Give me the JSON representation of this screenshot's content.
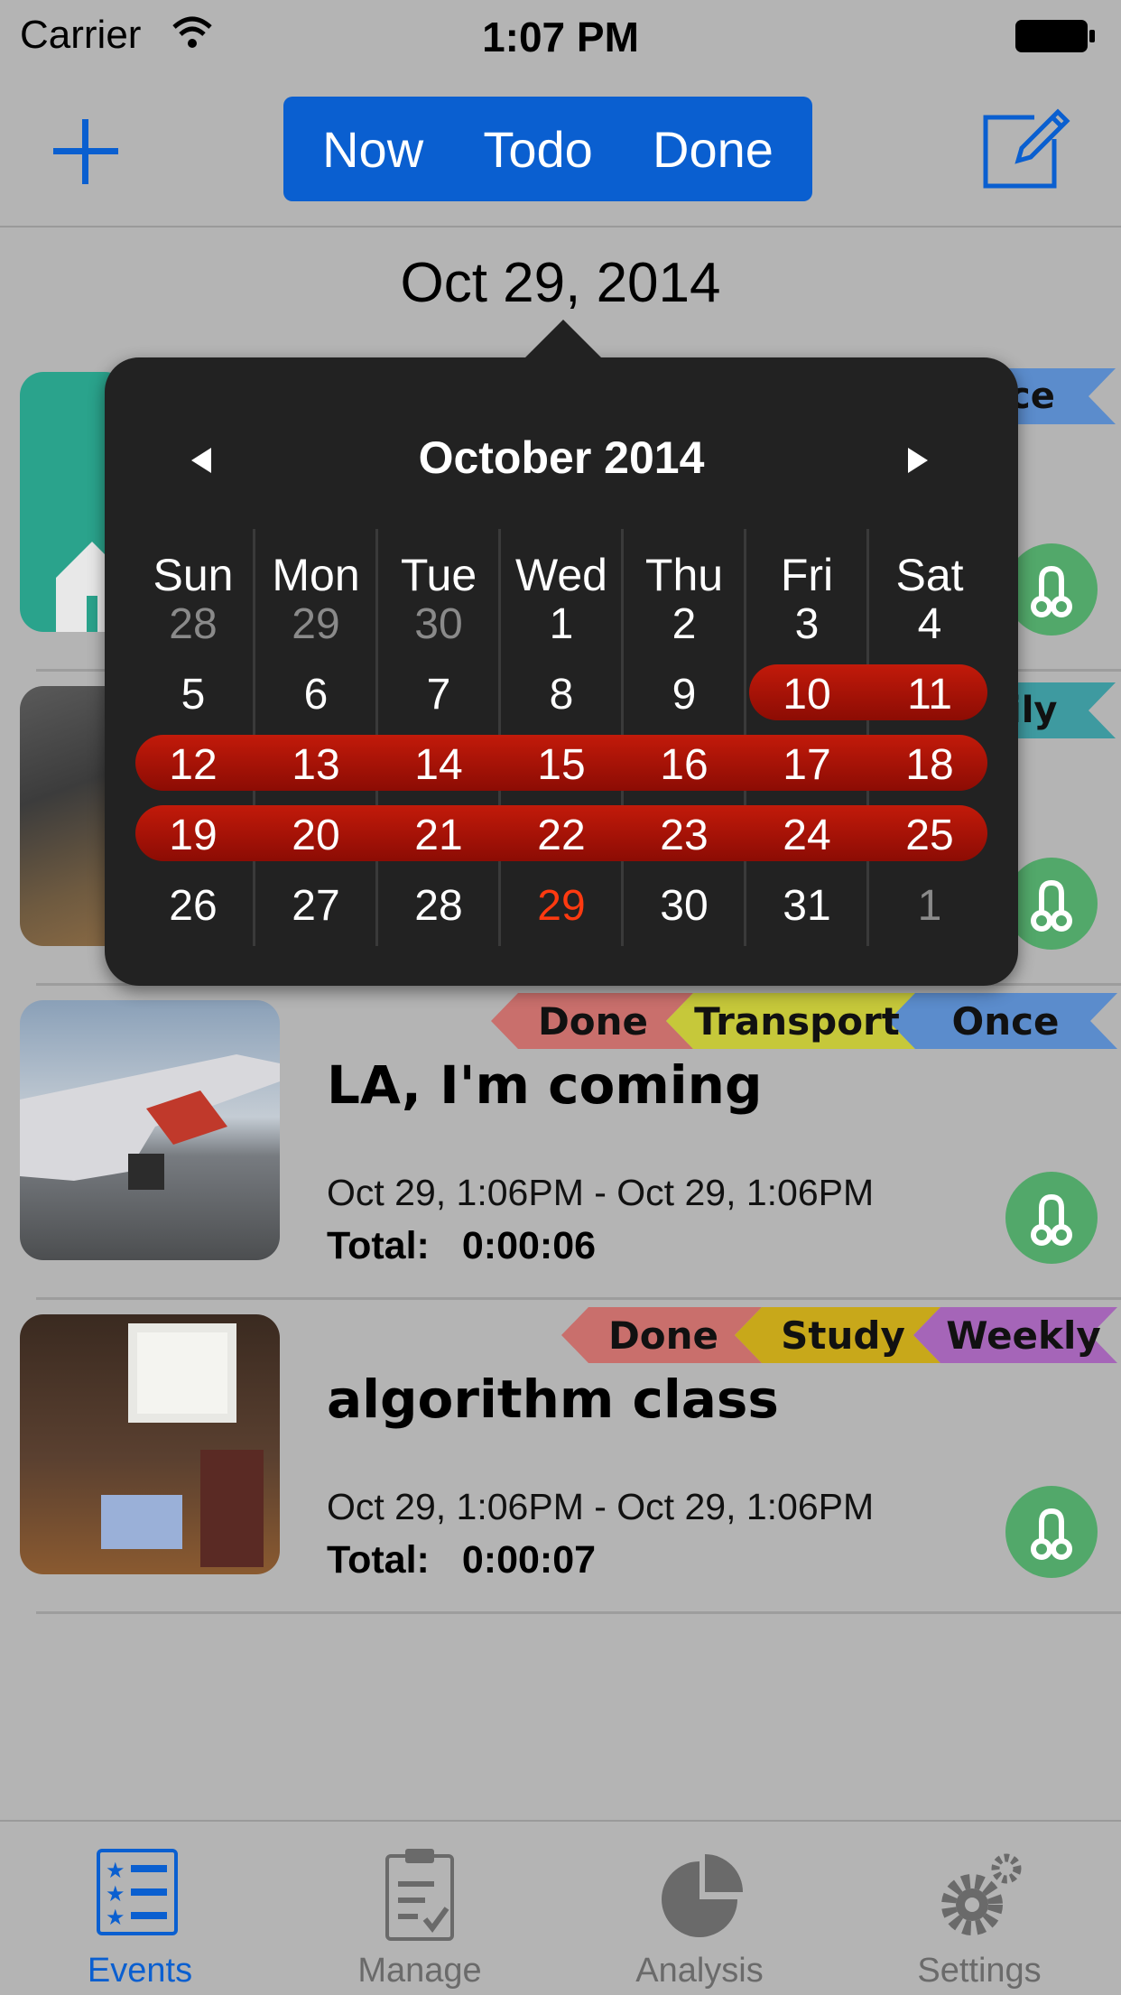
{
  "status": {
    "carrier": "Carrier",
    "time": "1:07 PM"
  },
  "nav": {
    "segments": [
      "Now",
      "Todo",
      "Done"
    ],
    "selected": "Now"
  },
  "date_header": "Oct 29, 2014",
  "calendar": {
    "month_title": "October 2014",
    "weekdays": [
      "Sun",
      "Mon",
      "Tue",
      "Wed",
      "Thu",
      "Fri",
      "Sat"
    ],
    "weeks": [
      [
        "28",
        "29",
        "30",
        "1",
        "2",
        "3",
        "4"
      ],
      [
        "5",
        "6",
        "7",
        "8",
        "9",
        "10",
        "11"
      ],
      [
        "12",
        "13",
        "14",
        "15",
        "16",
        "17",
        "18"
      ],
      [
        "19",
        "20",
        "21",
        "22",
        "23",
        "24",
        "25"
      ],
      [
        "26",
        "27",
        "28",
        "29",
        "30",
        "31",
        "1"
      ]
    ],
    "today": "29",
    "highlight_range": "Oct 10 - Oct 25"
  },
  "events": [
    {
      "tags": [
        "ce"
      ],
      "title": "",
      "times": "",
      "total_label": "",
      "total_value": ""
    },
    {
      "tags": [
        "ily"
      ],
      "title": "",
      "times": "",
      "total_label": "",
      "total_value": ""
    },
    {
      "tags": [
        "Done",
        "Transport",
        "Once"
      ],
      "title": "LA, I'm coming",
      "times": "Oct 29, 1:06PM - Oct 29, 1:06PM",
      "total_label": "Total:",
      "total_value": "0:00:06"
    },
    {
      "tags": [
        "Done",
        "Study",
        "Weekly"
      ],
      "title": "algorithm class",
      "times": "Oct 29, 1:06PM - Oct 29, 1:06PM",
      "total_label": "Total:",
      "total_value": "0:00:07"
    }
  ],
  "tab_bar": {
    "tabs": [
      {
        "label": "Events",
        "icon": "events-list-icon",
        "active": true
      },
      {
        "label": "Manage",
        "icon": "clipboard-icon",
        "active": false
      },
      {
        "label": "Analysis",
        "icon": "pie-chart-icon",
        "active": false
      },
      {
        "label": "Settings",
        "icon": "gears-icon",
        "active": false
      }
    ]
  },
  "colors": {
    "accent": "#0a5fd0",
    "highlight_band": "#b01508",
    "today": "#ff3a10",
    "route_button": "#52a86a"
  }
}
